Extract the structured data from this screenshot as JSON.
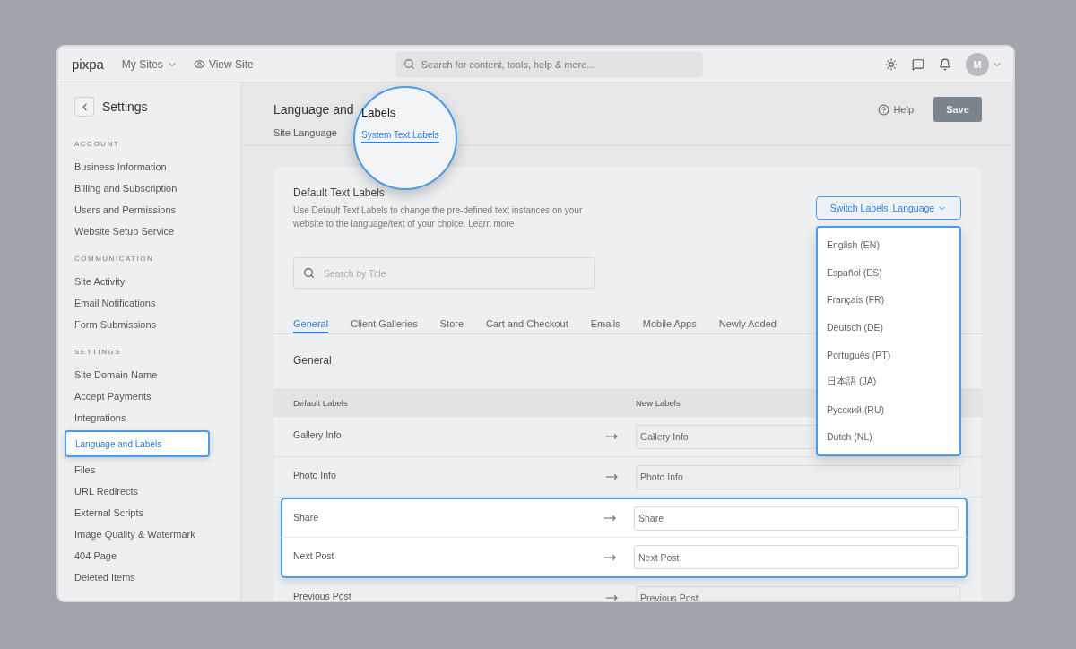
{
  "topbar": {
    "logo": "pixpa",
    "menu": "My Sites",
    "view_site": "View Site",
    "search": {
      "placeholder": "Search for content, tools, help & more..."
    },
    "avatar": "M"
  },
  "sidebar": {
    "title": "Settings",
    "sections": [
      {
        "heading": "ACCOUNT",
        "items": [
          {
            "label": "Business Information",
            "selected": false
          },
          {
            "label": "Billing and Subscription",
            "selected": false
          },
          {
            "label": "Users and Permissions",
            "selected": false
          },
          {
            "label": "Website Setup Service",
            "selected": false
          }
        ]
      },
      {
        "heading": "COMMUNICATION",
        "items": [
          {
            "label": "Site Activity",
            "selected": false
          },
          {
            "label": "Email Notifications",
            "selected": false
          },
          {
            "label": "Form Submissions",
            "selected": false
          }
        ]
      },
      {
        "heading": "SETTINGS",
        "items": [
          {
            "label": "Site Domain Name",
            "selected": false
          },
          {
            "label": "Accept Payments",
            "selected": false
          },
          {
            "label": "Integrations",
            "selected": false
          },
          {
            "label": "Language and Labels",
            "selected": true
          },
          {
            "label": "Files",
            "selected": false
          },
          {
            "label": "URL Redirects",
            "selected": false
          },
          {
            "label": "External Scripts",
            "selected": false
          },
          {
            "label": "Image Quality & Watermark",
            "selected": false
          },
          {
            "label": "404 Page",
            "selected": false
          },
          {
            "label": "Deleted Items",
            "selected": false
          }
        ]
      }
    ]
  },
  "header": {
    "title": "Language and",
    "magnified_title": "Labels",
    "help": "Help",
    "save": "Save",
    "tabs": [
      {
        "label": "Site Language",
        "selected": false
      },
      {
        "label": "System Text Labels",
        "selected": true
      }
    ]
  },
  "card": {
    "title": "Default Text Labels",
    "description": "Use Default Text Labels to change the pre-defined text instances on your website to the language/text of your choice.",
    "learn_more": "Learn more",
    "search": {
      "placeholder": "Search by Title"
    },
    "switch_button": "Switch Labels' Language",
    "languages": [
      "English (EN)",
      "Español (ES)",
      "Français (FR)",
      "Deutsch (DE)",
      "Português (PT)",
      "日本語 (JA)",
      "Русский (RU)",
      "Dutch (NL)"
    ],
    "categories": [
      {
        "label": "General",
        "selected": true
      },
      {
        "label": "Client Galleries",
        "selected": false
      },
      {
        "label": "Store",
        "selected": false
      },
      {
        "label": "Cart and Checkout",
        "selected": false
      },
      {
        "label": "Emails",
        "selected": false
      },
      {
        "label": "Mobile Apps",
        "selected": false
      },
      {
        "label": "Newly Added",
        "selected": false
      }
    ],
    "section_title": "General",
    "columns": [
      "Default Labels",
      "New Labels"
    ],
    "rows": [
      {
        "default": "Gallery Info",
        "value": "Gallery Info",
        "highlighted": false
      },
      {
        "default": "Photo Info",
        "value": "Photo Info",
        "highlighted": false
      },
      {
        "default": "Share",
        "value": "Share",
        "highlighted": true
      },
      {
        "default": "Next Post",
        "value": "Next Post",
        "highlighted": true
      },
      {
        "default": "Previous Post",
        "value": "Previous Post",
        "highlighted": false
      }
    ]
  }
}
